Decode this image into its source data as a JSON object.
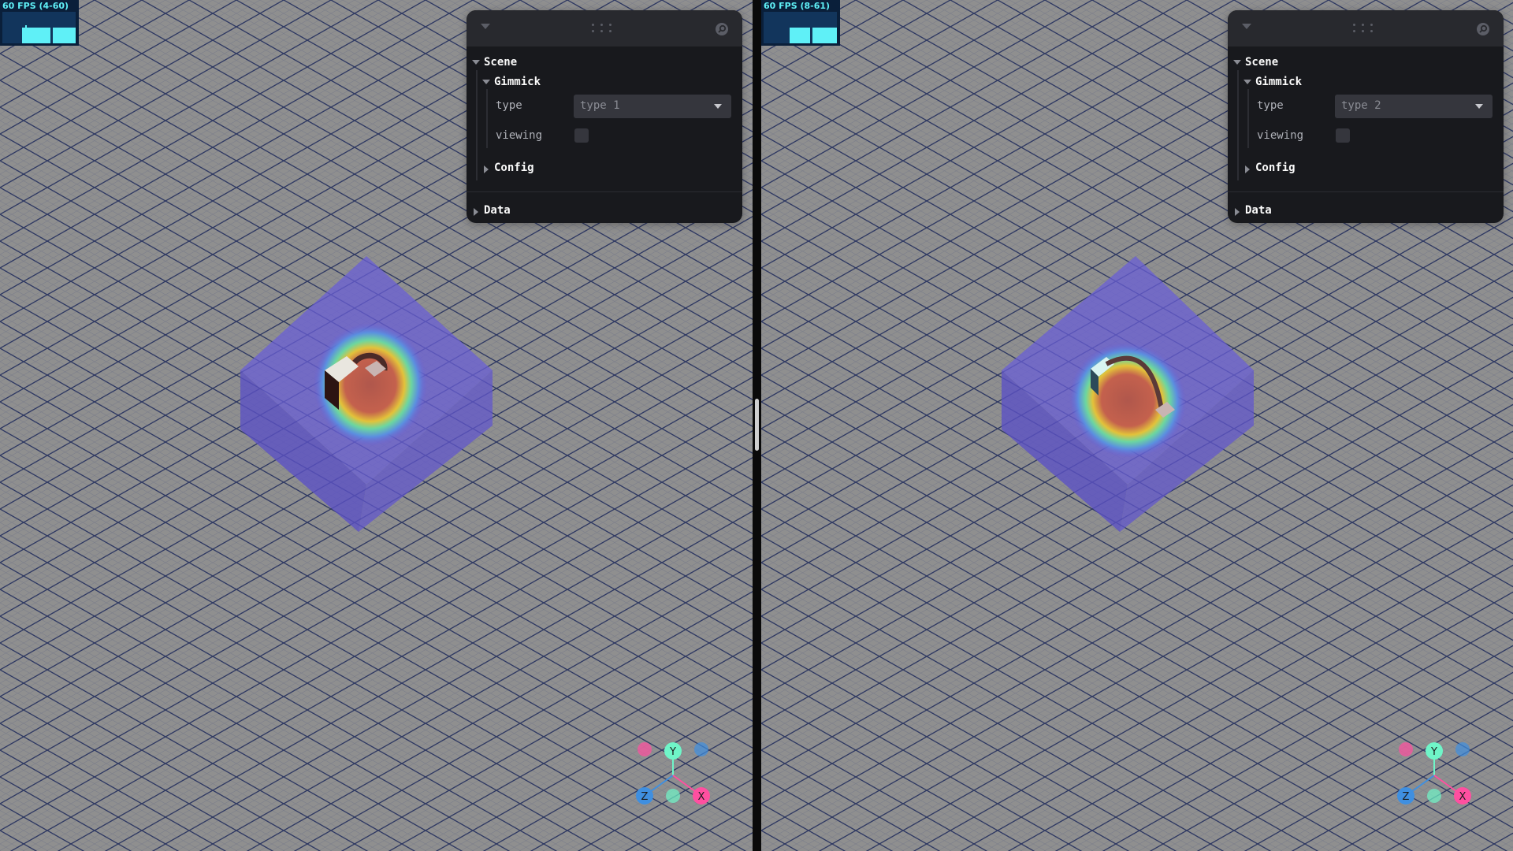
{
  "panes": [
    {
      "fps": {
        "label": "60 FPS (4-60)"
      },
      "panel": {
        "scene_label": "Scene",
        "gimmick_label": "Gimmick",
        "type_label": "type",
        "type_value": "type 1",
        "viewing_label": "viewing",
        "viewing_checked": false,
        "config_label": "Config",
        "data_label": "Data"
      },
      "gizmo": {
        "y": "Y",
        "z": "Z",
        "x": "X"
      }
    },
    {
      "fps": {
        "label": "60 FPS (8-61)"
      },
      "panel": {
        "scene_label": "Scene",
        "gimmick_label": "Gimmick",
        "type_label": "type",
        "type_value": "type 2",
        "viewing_label": "viewing",
        "viewing_checked": false,
        "config_label": "Config",
        "data_label": "Data"
      },
      "gizmo": {
        "y": "Y",
        "z": "Z",
        "x": "X"
      }
    }
  ],
  "colors": {
    "background": "#8f8f8f",
    "grid_line": "#1e2a5a",
    "fps_text": "#5ff0f7",
    "panel_bg": "#18191d",
    "axis_x": "#ff4fa0",
    "axis_y": "#6ff5c8",
    "axis_z": "#3f8fe0"
  }
}
